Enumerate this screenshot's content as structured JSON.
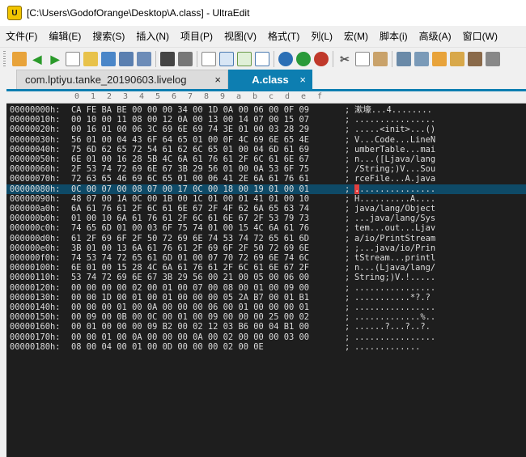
{
  "window": {
    "title": "[C:\\Users\\GodofOrange\\Desktop\\A.class] - UltraEdit"
  },
  "menu": [
    "文件(F)",
    "编辑(E)",
    "搜索(S)",
    "插入(N)",
    "项目(P)",
    "视图(V)",
    "格式(T)",
    "列(L)",
    "宏(M)",
    "脚本(i)",
    "高级(A)",
    "窗口(W)"
  ],
  "toolbar_icons": [
    "bookmark-icon",
    "back-arrow-icon",
    "forward-arrow-icon",
    "new-file-icon",
    "open-file-icon",
    "open-folder-icon",
    "save-icon",
    "save-all-icon",
    "print-icon",
    "print-preview-icon",
    "page-icon",
    "hex-edit-icon",
    "word-wrap-icon",
    "column-mode-icon",
    "uppercase-icon",
    "uppercase-alt-icon",
    "lowercase-icon",
    "cut-icon",
    "copy-icon",
    "paste-icon",
    "find-icon",
    "replace-icon",
    "find-files-icon",
    "macro-icon",
    "list-icon",
    "settings-icon"
  ],
  "tabs": {
    "inactive_label": "com.lptiyu.tanke_20190603.livelog",
    "active_label": "A.class",
    "close_glyph": "×"
  },
  "colors": {
    "active_tab": "#0d7eb1",
    "editor_bg": "#1e1e1e",
    "highlight_row": "#0e4a67",
    "cursor": "#e04040"
  },
  "column_header": [
    "0",
    "1",
    "2",
    "3",
    "4",
    "5",
    "6",
    "7",
    "8",
    "9",
    "a",
    "b",
    "c",
    "d",
    "e",
    "f"
  ],
  "hex_rows": [
    {
      "addr": "00000000h:",
      "bytes": "CA FE BA BE 00 00 00 34 00 1D 0A 00 06 00 0F 09",
      "ascii": "漱壕...4........"
    },
    {
      "addr": "00000010h:",
      "bytes": "00 10 00 11 08 00 12 0A 00 13 00 14 07 00 15 07",
      "ascii": "................"
    },
    {
      "addr": "00000020h:",
      "bytes": "00 16 01 00 06 3C 69 6E 69 74 3E 01 00 03 28 29",
      "ascii": ".....<init>...()"
    },
    {
      "addr": "00000030h:",
      "bytes": "56 01 00 04 43 6F 64 65 01 00 0F 4C 69 6E 65 4E",
      "ascii": "V...Code...LineN"
    },
    {
      "addr": "00000040h:",
      "bytes": "75 6D 62 65 72 54 61 62 6C 65 01 00 04 6D 61 69",
      "ascii": "umberTable...mai"
    },
    {
      "addr": "00000050h:",
      "bytes": "6E 01 00 16 28 5B 4C 6A 61 76 61 2F 6C 61 6E 67",
      "ascii": "n...([Ljava/lang"
    },
    {
      "addr": "00000060h:",
      "bytes": "2F 53 74 72 69 6E 67 3B 29 56 01 00 0A 53 6F 75",
      "ascii": "/String;)V...Sou"
    },
    {
      "addr": "00000070h:",
      "bytes": "72 63 65 46 69 6C 65 01 00 06 41 2E 6A 61 76 61",
      "ascii": "rceFile...A.java"
    },
    {
      "addr": "00000080h:",
      "bytes": "0C 00 07 00 08 07 00 17 0C 00 18 00 19 01 00 01",
      "ascii": "................",
      "highlight": true
    },
    {
      "addr": "00000090h:",
      "bytes": "48 07 00 1A 0C 00 1B 00 1C 01 00 01 41 01 00 10",
      "ascii": "H..........A...."
    },
    {
      "addr": "000000a0h:",
      "bytes": "6A 61 76 61 2F 6C 61 6E 67 2F 4F 62 6A 65 63 74",
      "ascii": "java/lang/Object"
    },
    {
      "addr": "000000b0h:",
      "bytes": "01 00 10 6A 61 76 61 2F 6C 61 6E 67 2F 53 79 73",
      "ascii": "...java/lang/Sys"
    },
    {
      "addr": "000000c0h:",
      "bytes": "74 65 6D 01 00 03 6F 75 74 01 00 15 4C 6A 61 76",
      "ascii": "tem...out...Ljav"
    },
    {
      "addr": "000000d0h:",
      "bytes": "61 2F 69 6F 2F 50 72 69 6E 74 53 74 72 65 61 6D",
      "ascii": "a/io/PrintStream"
    },
    {
      "addr": "000000e0h:",
      "bytes": "3B 01 00 13 6A 61 76 61 2F 69 6F 2F 50 72 69 6E",
      "ascii": ";...java/io/Prin"
    },
    {
      "addr": "000000f0h:",
      "bytes": "74 53 74 72 65 61 6D 01 00 07 70 72 69 6E 74 6C",
      "ascii": "tStream...printl"
    },
    {
      "addr": "00000100h:",
      "bytes": "6E 01 00 15 28 4C 6A 61 76 61 2F 6C 61 6E 67 2F",
      "ascii": "n...(Ljava/lang/"
    },
    {
      "addr": "00000110h:",
      "bytes": "53 74 72 69 6E 67 3B 29 56 00 21 00 05 00 06 00",
      "ascii": "String;)V.!....."
    },
    {
      "addr": "00000120h:",
      "bytes": "00 00 00 00 02 00 01 00 07 00 08 00 01 00 09 00",
      "ascii": "................"
    },
    {
      "addr": "00000130h:",
      "bytes": "00 00 1D 00 01 00 01 00 00 00 05 2A B7 00 01 B1",
      "ascii": "...........*?.?"
    },
    {
      "addr": "00000140h:",
      "bytes": "00 00 00 01 00 0A 00 00 00 06 00 01 00 00 00 01",
      "ascii": "................"
    },
    {
      "addr": "00000150h:",
      "bytes": "00 09 00 0B 00 0C 00 01 00 09 00 00 00 25 00 02",
      "ascii": ".............%.."
    },
    {
      "addr": "00000160h:",
      "bytes": "00 01 00 00 00 09 B2 00 02 12 03 B6 00 04 B1 00",
      "ascii": "......?...?..?."
    },
    {
      "addr": "00000170h:",
      "bytes": "00 00 01 00 0A 00 00 00 0A 00 02 00 00 00 03 00",
      "ascii": "................"
    },
    {
      "addr": "00000180h:",
      "bytes": "08 00 04 00 01 00 0D 00 00 00 02 00 0E",
      "ascii": "............."
    }
  ]
}
